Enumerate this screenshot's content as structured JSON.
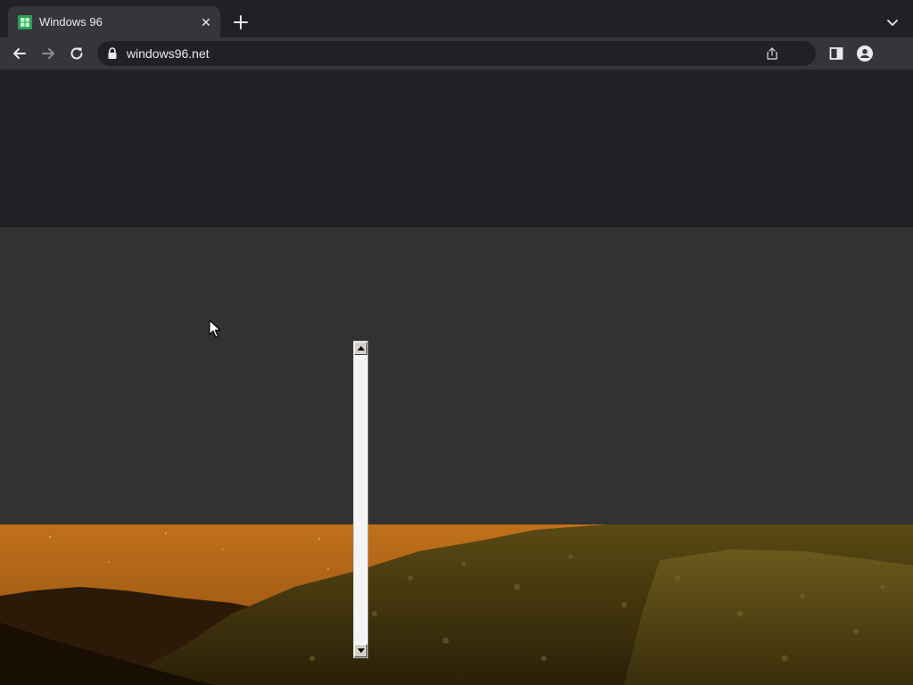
{
  "browser": {
    "tab": {
      "title": "Windows 96",
      "favicon": "windows96-logo-icon",
      "close_icon": "close-icon"
    },
    "new_tab_icon": "plus-icon",
    "tab_search_icon": "chevron-down-icon",
    "toolbar": {
      "back_icon": "arrow-left-icon",
      "forward_icon": "arrow-right-icon",
      "reload_icon": "reload-icon",
      "side_panel_icon": "side-panel-icon",
      "profile_icon": "profile-icon"
    },
    "omnibox": {
      "lock_icon": "lock-icon",
      "url": "windows96.net",
      "share_icon": "share-icon"
    }
  },
  "page": {
    "scrollbar": {
      "up_icon": "arrow-up-icon",
      "down_icon": "arrow-down-icon"
    },
    "wallpaper": "desert-mountains-night"
  },
  "colors": {
    "tab_strip": "#202124",
    "toolbar": "#35363a",
    "page_top": "#202124",
    "page_gray": "#323232",
    "wallpaper_sky": "#b86612"
  }
}
